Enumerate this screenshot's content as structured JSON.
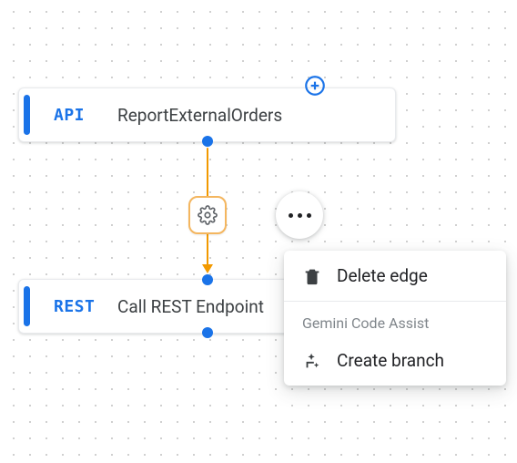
{
  "nodes": {
    "top": {
      "tag": "API",
      "title": "ReportExternalOrders"
    },
    "bottom": {
      "tag": "REST",
      "title": "Call REST Endpoint"
    }
  },
  "edge": {
    "gear_icon_name": "settings-icon"
  },
  "add_button": {
    "icon_name": "plus-icon"
  },
  "more_button": {
    "icon_name": "more-horiz-icon"
  },
  "context_menu": {
    "delete_label": "Delete edge",
    "section_label": "Gemini Code Assist",
    "create_branch_label": "Create branch"
  }
}
